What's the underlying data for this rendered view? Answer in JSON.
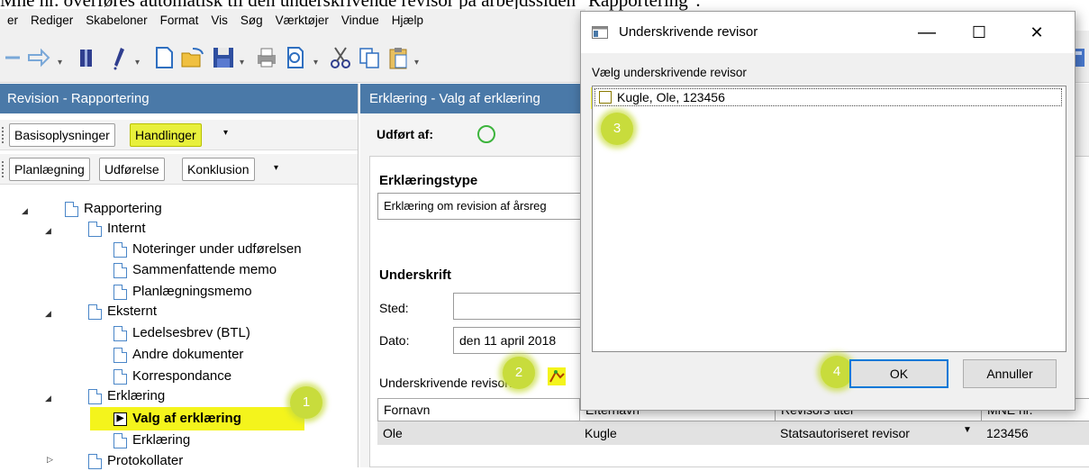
{
  "caption": "Mne nr. overføres automatisk til den underskrivende revisor på arbejdssiden \"Rapportering\".",
  "menu": [
    "er",
    "Rediger",
    "Skabeloner",
    "Format",
    "Vis",
    "Søg",
    "Værktøjer",
    "Vindue",
    "Hjælp"
  ],
  "left_panel": {
    "title": "Revision - Rapportering",
    "tabs_row1": [
      "Basisoplysninger",
      "Handlinger"
    ],
    "tabs_row2": [
      "Planlægning",
      "Udførelse",
      "Konklusion"
    ],
    "tree": [
      "Rapportering",
      "Internt",
      "Noteringer under udførelsen",
      "Sammenfattende memo",
      "Planlægningsmemo",
      "Eksternt",
      "Ledelsesbrev (BTL)",
      "Andre dokumenter",
      "Korrespondance",
      "Erklæring",
      "Valg af erklæring",
      "Erklæring",
      "Protokollater"
    ]
  },
  "main": {
    "title": "Erklæring - Valg af erklæring",
    "performed_by_label": "Udført af:",
    "declaration_type_heading": "Erklæringstype",
    "declaration_type_value": "Erklæring om revision af årsreg",
    "signature_heading": "Underskrift",
    "place_label": "Sted:",
    "place_value": "",
    "date_label": "Dato:",
    "date_value": "den 11 april 2018",
    "signing_auditor_label": "Underskrivende revisor:",
    "grid_headers": [
      "Fornavn",
      "Efternavn",
      "Revisors titel",
      "MNE nr."
    ],
    "grid_row": [
      "Ole",
      "Kugle",
      "Statsautoriseret revisor",
      "123456"
    ]
  },
  "dialog": {
    "title": "Underskrivende revisor",
    "minimize": "—",
    "maximize": "☐",
    "close": "✕",
    "list_label": "Vælg underskrivende revisor",
    "items": [
      "Kugle, Ole, 123456"
    ],
    "ok": "OK",
    "cancel": "Annuller"
  },
  "badges": [
    "1",
    "2",
    "3",
    "4"
  ],
  "colors": {
    "accent_header": "#4a79a8",
    "highlight": "#f4f41c",
    "badge": "#c8dc3c",
    "focus": "#0078d7"
  }
}
